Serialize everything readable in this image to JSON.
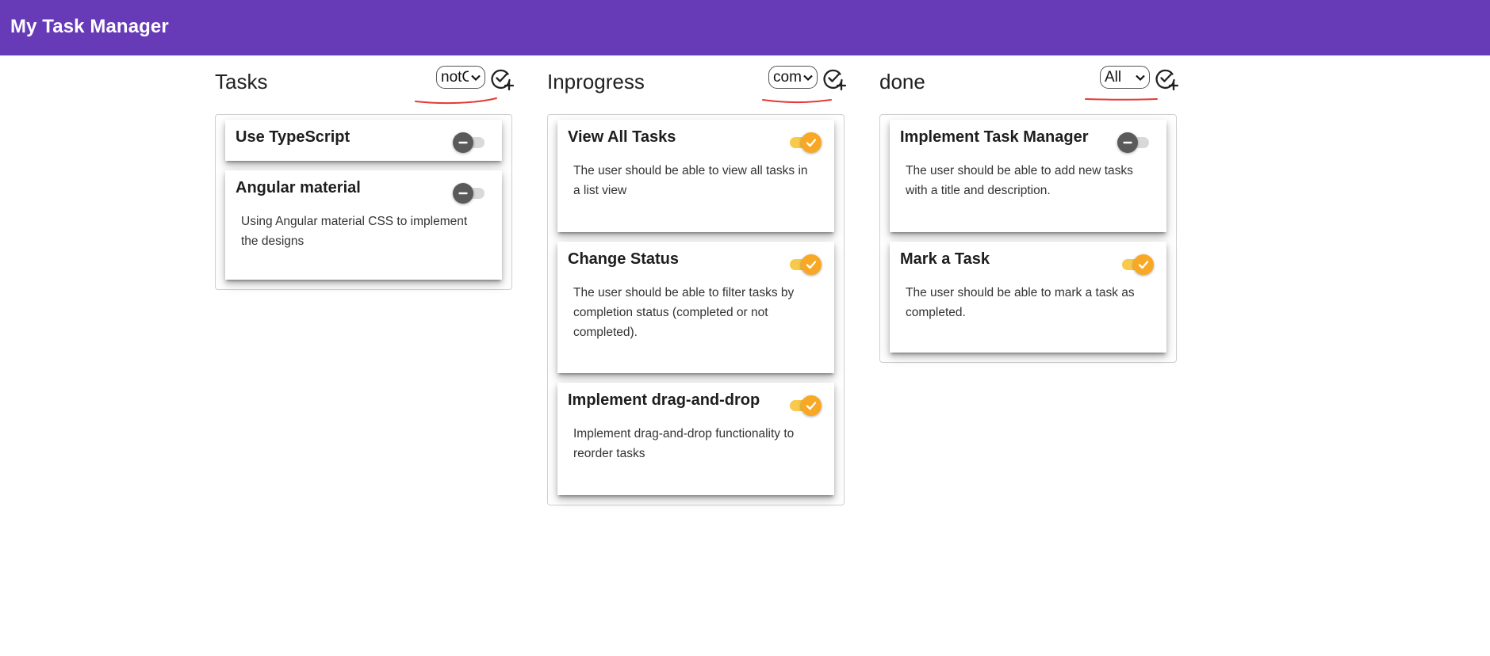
{
  "app": {
    "title": "My Task Manager"
  },
  "colors": {
    "toolbar": "#673ab7",
    "toggle_on": "#f9a825",
    "annotation": "#e53935"
  },
  "columns": [
    {
      "title": "Tasks",
      "filter": "notC",
      "tasks": [
        {
          "title": "Use TypeScript",
          "description": "",
          "done": false
        },
        {
          "title": "Angular material",
          "description": "Using Angular material CSS to implement the designs",
          "done": false
        }
      ]
    },
    {
      "title": "Inprogress",
      "filter": "com",
      "tasks": [
        {
          "title": "View All Tasks",
          "description": "The user should be able to view all tasks in a list view",
          "done": true
        },
        {
          "title": "Change Status",
          "description": "The user should be able to filter tasks by completion status (completed or not completed).",
          "done": true
        },
        {
          "title": "Implement drag-and-drop",
          "description": "Implement drag-and-drop functionality to reorder tasks",
          "done": true
        }
      ]
    },
    {
      "title": "done",
      "filter": "All",
      "tasks": [
        {
          "title": "Implement Task Manager",
          "description": "The user should be able to add new tasks with a title and description.",
          "done": false
        },
        {
          "title": "Mark a Task",
          "description": "The user should be able to mark a task as completed.",
          "done": true
        }
      ]
    }
  ]
}
